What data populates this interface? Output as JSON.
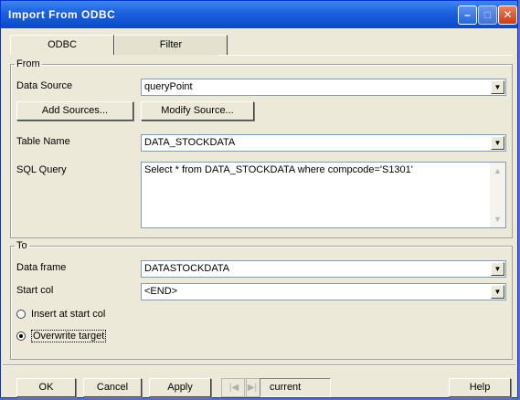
{
  "window": {
    "title": "Import From ODBC"
  },
  "tabs": [
    {
      "label": "ODBC",
      "active": true
    },
    {
      "label": "Filter",
      "active": false
    }
  ],
  "from": {
    "legend": "From",
    "data_source_label": "Data Source",
    "data_source_value": "queryPoint",
    "add_sources_label": "Add Sources...",
    "modify_source_label": "Modify Source...",
    "table_name_label": "Table Name",
    "table_name_value": "DATA_STOCKDATA",
    "sql_query_label": "SQL Query",
    "sql_query_value": "Select * from DATA_STOCKDATA where compcode='S1301'"
  },
  "to": {
    "legend": "To",
    "data_frame_label": "Data frame",
    "data_frame_value": "DATASTOCKDATA",
    "start_col_label": "Start col",
    "start_col_value": "<END>",
    "insert_label": "Insert at start col",
    "overwrite_label": "Overwrite target",
    "selected_option": "overwrite"
  },
  "footer": {
    "ok_label": "OK",
    "cancel_label": "Cancel",
    "apply_label": "Apply",
    "current_label": "current",
    "help_label": "Help"
  },
  "colors": {
    "titlebar": "#0a49c9",
    "face": "#ece9d8",
    "close": "#c83c17"
  }
}
